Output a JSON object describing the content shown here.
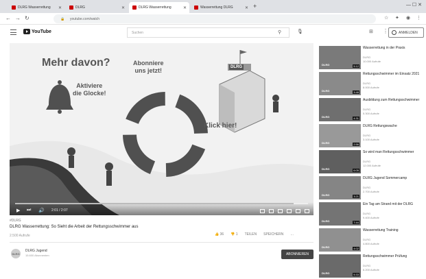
{
  "browser": {
    "tabs": [
      {
        "label": "DLRG Wasserrettung"
      },
      {
        "label": "DLRG"
      },
      {
        "label": "DLRG Wasserrettung"
      },
      {
        "label": "Wasserrettung DLRG"
      }
    ],
    "new_tab": "+",
    "address": "youtube.com/watch",
    "window_controls": "— ☐ ✕"
  },
  "header": {
    "logo_text": "YouTube",
    "search_placeholder": "Suchen",
    "signin_label": "ANMELDEN"
  },
  "video": {
    "overlay": {
      "headline": "Mehr davon?",
      "bell_text_1": "Aktiviere",
      "bell_text_2": "die Glocke!",
      "subscribe_text_1": "Abonniere",
      "subscribe_text_2": "uns jetzt!",
      "click_text": "Klick hier!",
      "brand": "DLRG"
    },
    "time": "2:01 / 2:07",
    "progress": 0.95,
    "hashtags": "#DLRG",
    "title": "DLRG Wasserrettung: So Sieht die Arbeit der Rettungsschwimmer aus",
    "views": "2.500 Aufrufe",
    "actions": {
      "like": "👍 36",
      "dislike": "👎 1",
      "share": "TEILEN",
      "save": "SPEICHERN",
      "more": "…"
    },
    "channel": {
      "avatar_text": "DLRG",
      "name": "DLRG Jugend",
      "subscribers": "15.600 Abonnenten",
      "subscribe_label": "ABONNIEREN"
    }
  },
  "recommendations": [
    {
      "title": "Wasserrettung in der Praxis",
      "channel": "DLRG",
      "meta": "10.000 Aufrufe",
      "duration": "5:12",
      "logo": "DLRG"
    },
    {
      "title": "Rettungsschwimmer im Einsatz 2021",
      "channel": "DLRG",
      "meta": "8.000 Aufrufe",
      "duration": "3:48",
      "logo": "DLRG"
    },
    {
      "title": "Ausbildung zum Rettungsschwimmer",
      "channel": "DLRG",
      "meta": "5.300 Aufrufe",
      "duration": "4:31",
      "logo": "DLRG"
    },
    {
      "title": "DLRG Rettungswache",
      "channel": "DLRG",
      "meta": "3.100 Aufrufe",
      "duration": "2:56",
      "logo": "DLRG"
    },
    {
      "title": "So wird man Rettungsschwimmer",
      "channel": "DLRG",
      "meta": "12.000 Aufrufe",
      "duration": "6:05",
      "logo": "DLRG"
    },
    {
      "title": "DLRG Jugend Sommercamp",
      "channel": "DLRG",
      "meta": "2.700 Aufrufe",
      "duration": "3:21",
      "logo": "DLRG"
    },
    {
      "title": "Ein Tag am Strand mit der DLRG",
      "channel": "DLRG",
      "meta": "9.400 Aufrufe",
      "duration": "7:44",
      "logo": "DLRG"
    },
    {
      "title": "Wasserrettung Training",
      "channel": "DLRG",
      "meta": "4.800 Aufrufe",
      "duration": "4:02",
      "logo": "DLRG"
    },
    {
      "title": "Rettungsschwimmer Prüfung",
      "channel": "DLRG",
      "meta": "6.200 Aufrufe",
      "duration": "5:33",
      "logo": "DLRG"
    }
  ]
}
